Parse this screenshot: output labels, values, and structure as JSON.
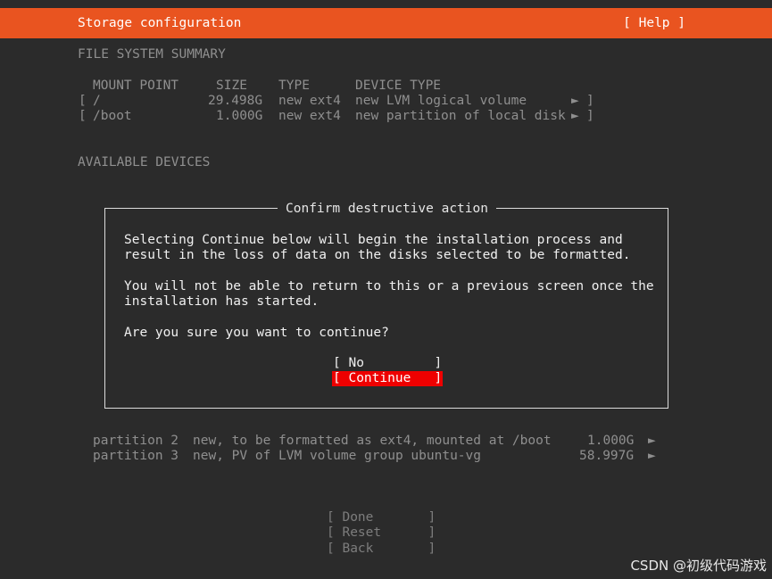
{
  "header": {
    "title": "Storage configuration",
    "help": "[ Help ]"
  },
  "summary": {
    "heading": "FILE SYSTEM SUMMARY",
    "columns": [
      "MOUNT POINT",
      "SIZE",
      "TYPE",
      "DEVICE TYPE"
    ],
    "rows": [
      {
        "open": "[",
        "mount": "/",
        "size": "29.498G",
        "type": "new ext4",
        "device": "new LVM logical volume",
        "arrow": "►",
        "close": "]"
      },
      {
        "open": "[",
        "mount": "/boot",
        "size": "1.000G",
        "type": "new ext4",
        "device": "new partition of local disk",
        "arrow": "►",
        "close": "]"
      }
    ]
  },
  "available": {
    "heading": "AVAILABLE DEVICES",
    "partitions": [
      {
        "name": "partition 2",
        "desc": "new, to be formatted as ext4, mounted at /boot",
        "size": "1.000G",
        "arrow": "►"
      },
      {
        "name": "partition 3",
        "desc": "new, PV of LVM volume group ubuntu-vg",
        "size": "58.997G",
        "arrow": "►"
      }
    ]
  },
  "dialog": {
    "title": "Confirm destructive action",
    "line1": "Selecting Continue below will begin the installation process and",
    "line2": "result in the loss of data on the disks selected to be formatted.",
    "line3": "You will not be able to return to this or a previous screen once the",
    "line4": "installation has started.",
    "question": "Are you sure you want to continue?",
    "no_label": "[ No         ]",
    "continue_label": "[ Continue   ]"
  },
  "footer_buttons": {
    "done": "[ Done       ]",
    "reset": "[ Reset      ]",
    "back": "[ Back       ]"
  },
  "watermark": "CSDN @初级代码游戏",
  "colors": {
    "header_bg": "#e95420",
    "background": "#2b2b2b",
    "selected_button_bg": "#ee0000"
  }
}
